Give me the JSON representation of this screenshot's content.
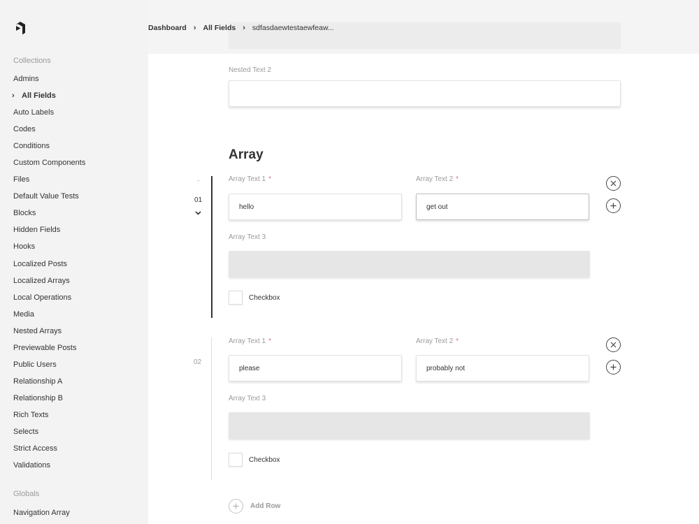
{
  "sidebar": {
    "collections_label": "Collections",
    "collections": [
      {
        "label": "Admins"
      },
      {
        "label": "All Fields",
        "active": true
      },
      {
        "label": "Auto Labels"
      },
      {
        "label": "Codes"
      },
      {
        "label": "Conditions"
      },
      {
        "label": "Custom Components"
      },
      {
        "label": "Files"
      },
      {
        "label": "Default Value Tests"
      },
      {
        "label": "Blocks"
      },
      {
        "label": "Hidden Fields"
      },
      {
        "label": "Hooks"
      },
      {
        "label": "Localized Posts"
      },
      {
        "label": "Localized Arrays"
      },
      {
        "label": "Local Operations"
      },
      {
        "label": "Media"
      },
      {
        "label": "Nested Arrays"
      },
      {
        "label": "Previewable Posts"
      },
      {
        "label": "Public Users"
      },
      {
        "label": "Relationship A"
      },
      {
        "label": "Relationship B"
      },
      {
        "label": "Rich Texts"
      },
      {
        "label": "Selects"
      },
      {
        "label": "Strict Access"
      },
      {
        "label": "Validations"
      }
    ],
    "globals_label": "Globals",
    "globals": [
      {
        "label": "Navigation Array"
      }
    ]
  },
  "header": {
    "breadcrumb": [
      {
        "label": "Dashboard"
      },
      {
        "label": "All Fields"
      },
      {
        "label": "sdfasdaewtestaewfeaw..."
      }
    ]
  },
  "main": {
    "nested_text_2": {
      "label": "Nested Text 2",
      "value": ""
    },
    "array_title": "Array",
    "rows": [
      {
        "number": "01",
        "text1_label": "Array Text 1",
        "text1_value": "hello",
        "text2_label": "Array Text 2",
        "text2_value": "get out",
        "text3_label": "Array Text 3",
        "text3_value": "",
        "checkbox_label": "Checkbox"
      },
      {
        "number": "02",
        "text1_label": "Array Text 1",
        "text1_value": "please",
        "text2_label": "Array Text 2",
        "text2_value": "probably not",
        "text3_label": "Array Text 3",
        "text3_value": "",
        "checkbox_label": "Checkbox"
      }
    ],
    "required_marker": "*",
    "add_row_label": "Add Row"
  },
  "colors": {
    "sidebar_bg": "#f3f3f3",
    "text": "#333333",
    "muted": "#9a9a9a",
    "required": "#e57373",
    "disabled_input": "#e6e6e6"
  }
}
